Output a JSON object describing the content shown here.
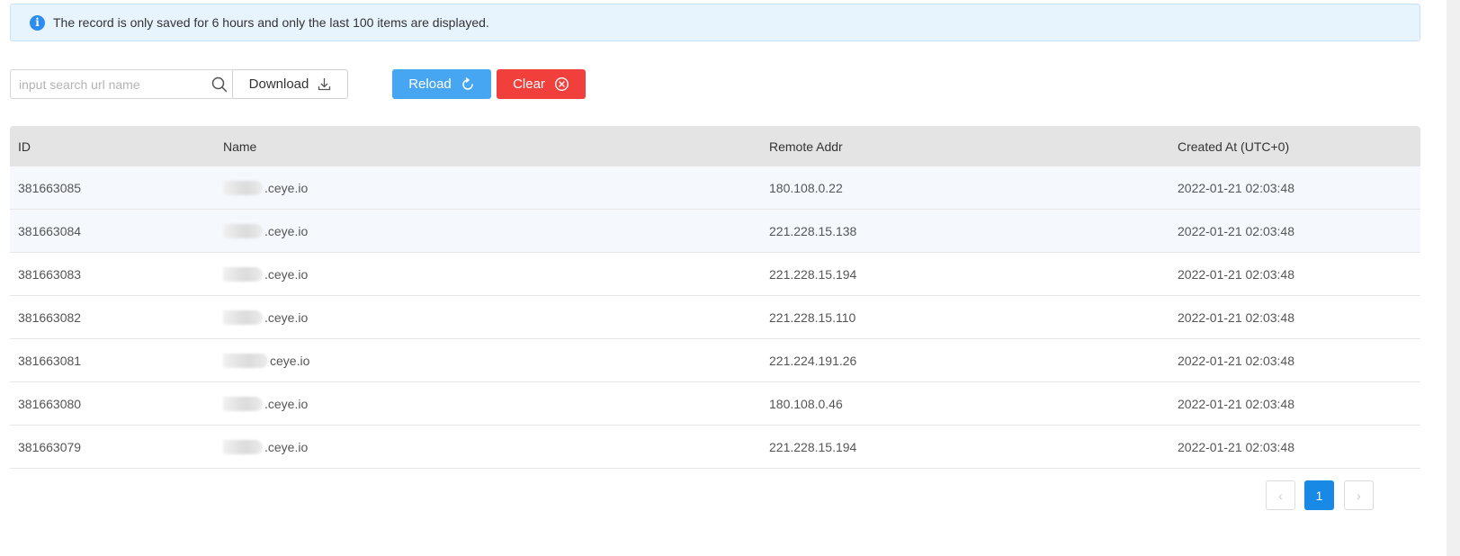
{
  "alert": {
    "icon": "info-icon",
    "text": "The record is only saved for 6 hours and only the last 100 items are displayed."
  },
  "toolbar": {
    "search_placeholder": "input search url name",
    "search_value": "",
    "download_label": "Download",
    "reload_label": "Reload",
    "clear_label": "Clear"
  },
  "table": {
    "columns": [
      "ID",
      "Name",
      "Remote Addr",
      "Created At (UTC+0)"
    ],
    "rows": [
      {
        "id": "381663085",
        "name": ".ceye.io",
        "addr": "180.108.0.22",
        "created": "2022-01-21 02:03:48"
      },
      {
        "id": "381663084",
        "name": ".ceye.io",
        "addr": "221.228.15.138",
        "created": "2022-01-21 02:03:48"
      },
      {
        "id": "381663083",
        "name": ".ceye.io",
        "addr": "221.228.15.194",
        "created": "2022-01-21 02:03:48"
      },
      {
        "id": "381663082",
        "name": ".ceye.io",
        "addr": "221.228.15.110",
        "created": "2022-01-21 02:03:48"
      },
      {
        "id": "381663081",
        "name": "ceye.io",
        "addr": "221.224.191.26",
        "created": "2022-01-21 02:03:48"
      },
      {
        "id": "381663080",
        "name": ".ceye.io",
        "addr": "180.108.0.46",
        "created": "2022-01-21 02:03:48"
      },
      {
        "id": "381663079",
        "name": ".ceye.io",
        "addr": "221.228.15.194",
        "created": "2022-01-21 02:03:48"
      }
    ]
  },
  "pagination": {
    "prev": "‹",
    "current_page": "1",
    "next": "›"
  },
  "colors": {
    "alert_bg": "#e8f4fd",
    "info_blue": "#2d8cf0",
    "reload_bg": "#47a6f1",
    "clear_bg": "#f1403c",
    "page_active": "#1989e6",
    "header_bg": "#e4e4e4"
  }
}
